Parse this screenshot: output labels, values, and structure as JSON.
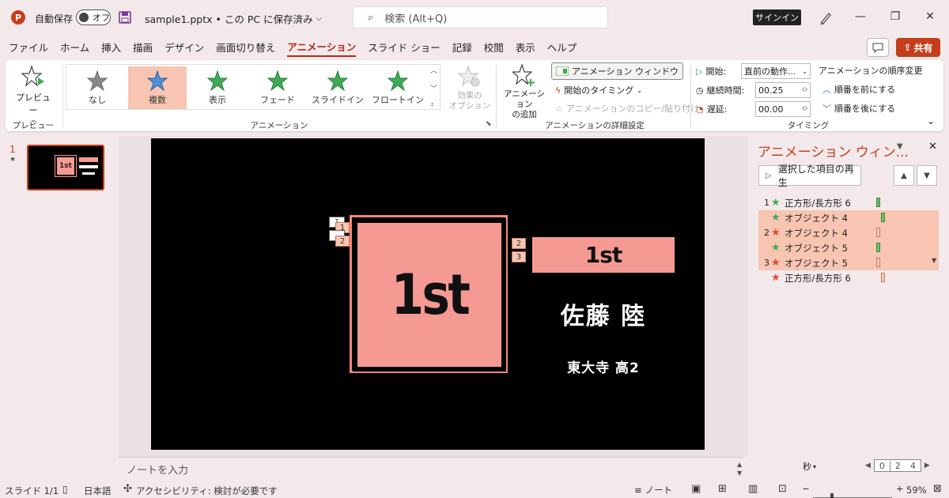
{
  "titlebar": {
    "autosave_label": "自動保存",
    "autosave_state": "オフ",
    "filename": "sample1.pptx • この PC に保存済み",
    "search_placeholder": "検索 (Alt+Q)",
    "signin": "サインイン"
  },
  "menu": {
    "items": [
      "ファイル",
      "ホーム",
      "挿入",
      "描画",
      "デザイン",
      "画面切り替え",
      "アニメーション",
      "スライド ショー",
      "記録",
      "校閲",
      "表示",
      "ヘルプ"
    ],
    "active": "アニメーション",
    "share": "共有"
  },
  "ribbon": {
    "preview_btn": "プレビュー",
    "preview_group": "プレビュー",
    "gallery": [
      {
        "label": "なし",
        "color": "#8a8a8a"
      },
      {
        "label": "複数",
        "color": "#4f8fd6"
      },
      {
        "label": "表示",
        "color": "#3faa55"
      },
      {
        "label": "フェード",
        "color": "#3faa55"
      },
      {
        "label": "スライドイン",
        "color": "#3faa55"
      },
      {
        "label": "フロートイン",
        "color": "#3faa55"
      }
    ],
    "effect_options": "効果の\nオプション",
    "anim_group": "アニメーション",
    "add_anim": "アニメーション\nの追加",
    "anim_window": "アニメーション ウィンドウ",
    "start_timing": "開始のタイミング",
    "copy_anim": "アニメーションのコピー/貼り付け",
    "detail_group": "アニメーションの詳細設定",
    "start_label": "開始:",
    "start_value": "直前の動作...",
    "duration_label": "継続時間:",
    "duration_value": "00.25",
    "delay_label": "遅延:",
    "delay_value": "00.00",
    "reorder_title": "アニメーションの順序変更",
    "move_earlier": "順番を前にする",
    "move_later": "順番を後にする",
    "timing_group": "タイミング"
  },
  "thumbs": {
    "number": "1",
    "star": "★"
  },
  "slide": {
    "big_text": "1st",
    "bar_text": "1st",
    "name": "佐藤 陸",
    "school": "東大寺 高2",
    "tags_left": [
      "1",
      "1",
      "2",
      "2"
    ],
    "tags_right": [
      "2",
      "3"
    ]
  },
  "notes_placeholder": "ノートを入力",
  "animpane": {
    "title": "アニメーション ウィン...",
    "play": "選択した項目の再生",
    "rows": [
      {
        "num": "1",
        "name": "正方形/長方形 6",
        "icon": "green-star",
        "hl": false,
        "bar": "g",
        "barPos": 0
      },
      {
        "num": "",
        "name": "オブジェクト 4",
        "icon": "green-star-small",
        "hl": true,
        "bar": "g",
        "barPos": 1
      },
      {
        "num": "2",
        "name": "オブジェクト 4",
        "icon": "red-star",
        "hl": true,
        "bar": "r",
        "barPos": 0
      },
      {
        "num": "",
        "name": "オブジェクト 5",
        "icon": "green-star-small",
        "hl": true,
        "bar": "g",
        "barPos": 0
      },
      {
        "num": "3",
        "name": "オブジェクト 5",
        "icon": "red-star",
        "hl": true,
        "bar": "r",
        "barPos": 0
      },
      {
        "num": "",
        "name": "正方形/長方形 6",
        "icon": "red-star",
        "hl": false,
        "bar": "r",
        "barPos": 1
      }
    ],
    "seconds": "秒",
    "timeline": [
      "0",
      "2",
      "4"
    ]
  },
  "status": {
    "slide": "スライド 1/1",
    "lang": "日本語",
    "accessibility": "アクセシビリティ: 検討が必要です",
    "notes": "ノート",
    "zoom": "59%"
  }
}
